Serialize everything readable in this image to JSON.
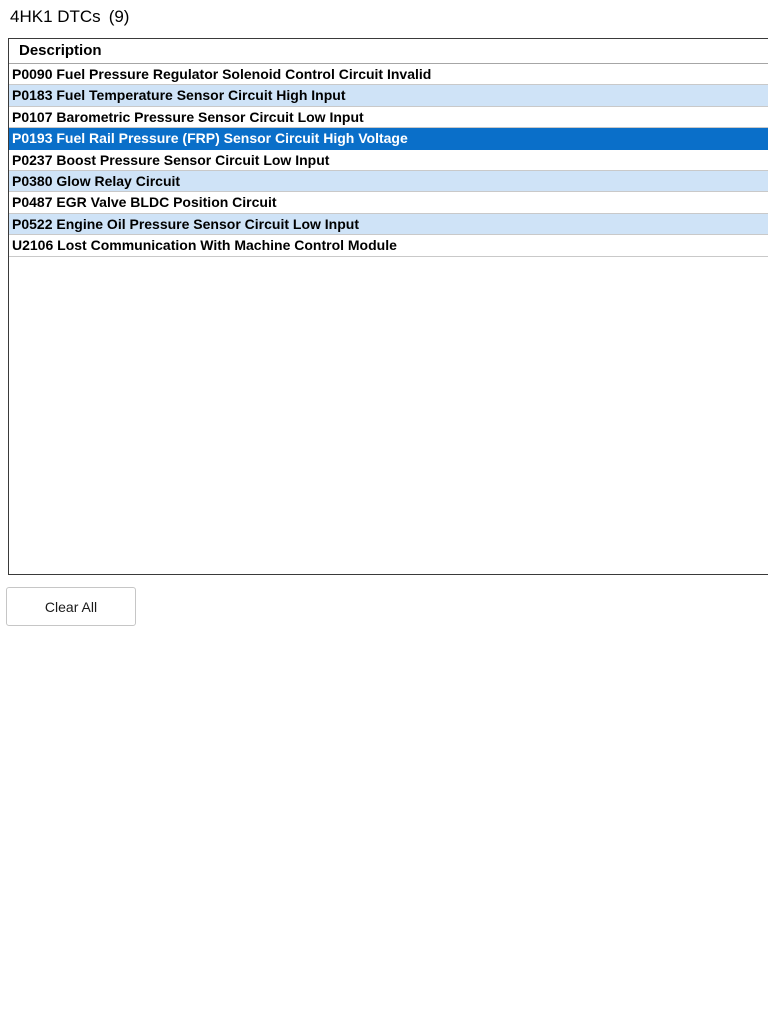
{
  "header": {
    "title": "4HK1 DTCs",
    "count": "(9)"
  },
  "table": {
    "column_header": "Description",
    "rows": [
      {
        "text": "P0090 Fuel Pressure Regulator Solenoid Control Circuit Invalid",
        "state": "normal"
      },
      {
        "text": "P0183 Fuel Temperature Sensor Circuit High Input",
        "state": "alt"
      },
      {
        "text": "P0107 Barometric Pressure Sensor Circuit Low Input",
        "state": "normal"
      },
      {
        "text": "P0193 Fuel Rail Pressure (FRP) Sensor Circuit High Voltage",
        "state": "selected"
      },
      {
        "text": "P0237 Boost Pressure Sensor Circuit Low Input",
        "state": "normal"
      },
      {
        "text": "P0380 Glow Relay Circuit",
        "state": "alt"
      },
      {
        "text": "P0487 EGR Valve BLDC Position Circuit",
        "state": "normal"
      },
      {
        "text": "P0522 Engine Oil Pressure Sensor Circuit Low Input",
        "state": "alt"
      },
      {
        "text": "U2106 Lost Communication With Machine Control Module",
        "state": "normal"
      }
    ]
  },
  "actions": {
    "clear_all_label": "Clear All"
  },
  "colors": {
    "alt_row": "#cfe3f7",
    "selected_row": "#0a6fc9",
    "selected_text": "#ffffff"
  }
}
